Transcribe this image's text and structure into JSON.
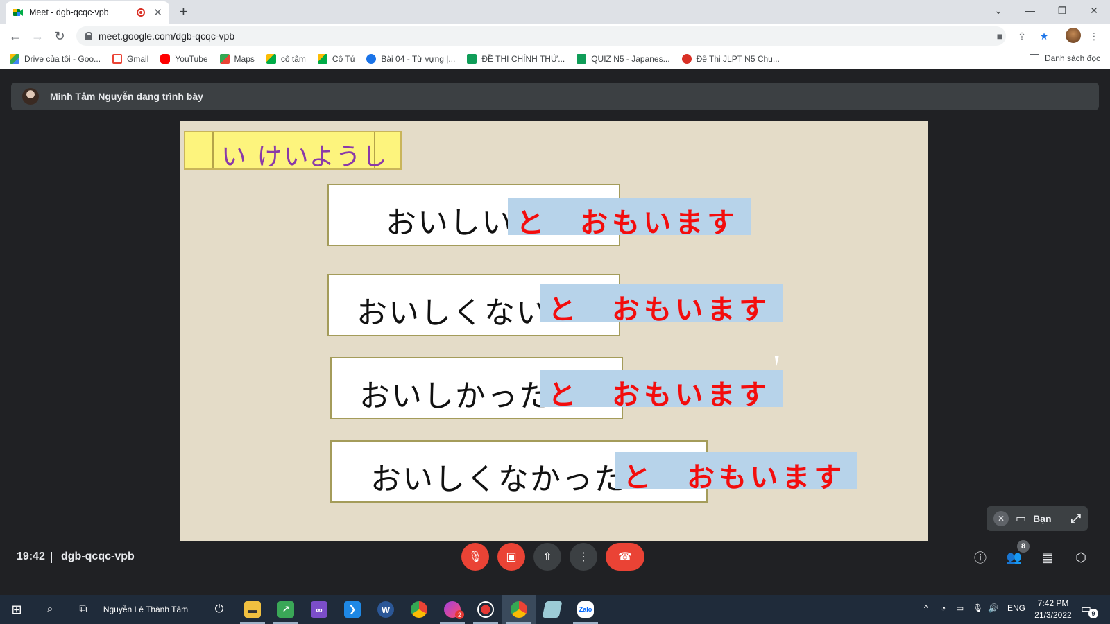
{
  "browser": {
    "tab_title": "Meet - dgb-qcqc-vpb",
    "tab_close": "✕",
    "new_tab": "+",
    "window_controls": [
      "⌄",
      "—",
      "❐",
      "✕"
    ],
    "url": "meet.google.com/dgb-qcqc-vpb",
    "bookmarks": [
      {
        "label": "Drive của tôi - Goo...",
        "icon": "drive-icon",
        "color": "#34a853"
      },
      {
        "label": "Gmail",
        "icon": "gmail-icon",
        "color": "#ea4335"
      },
      {
        "label": "YouTube",
        "icon": "youtube-icon",
        "color": "#ff0000"
      },
      {
        "label": "Maps",
        "icon": "maps-icon",
        "color": "#34a853"
      },
      {
        "label": "cô tâm",
        "icon": "meet-icon",
        "color": "#00897b"
      },
      {
        "label": "Cô Tú",
        "icon": "meet-icon",
        "color": "#00897b"
      },
      {
        "label": "Bài 04 - Từ vựng |...",
        "icon": "site-icon",
        "color": "#1a73e8"
      },
      {
        "label": "ĐỀ THI CHÍNH THỨ...",
        "icon": "sheets-icon",
        "color": "#0f9d58"
      },
      {
        "label": "QUIZ N5 - Japanes...",
        "icon": "sheets-icon",
        "color": "#0f9d58"
      },
      {
        "label": "Đề Thi JLPT N5 Chu...",
        "icon": "site-icon",
        "color": "#d93025"
      }
    ],
    "reading_list": "Danh sách đọc"
  },
  "meet": {
    "presenter_text": "Minh Tâm Nguyễn đang trình bày",
    "self_label": "Bạn",
    "time": "19:42",
    "meeting_code": "dgb-qcqc-vpb",
    "participants_count": "8"
  },
  "slide": {
    "title": "い けいようし",
    "rows": [
      {
        "base": "おいしい",
        "suffix": "と　おもいます"
      },
      {
        "base": "おいしくない",
        "suffix": "と　おもいます"
      },
      {
        "base": "おいしかった",
        "suffix": "と　おもいます"
      },
      {
        "base": "おいしくなかった",
        "suffix": "と　おもいます"
      }
    ]
  },
  "taskbar": {
    "user": "Nguyễn Lê Thành Tâm",
    "language": "ENG",
    "clock_time": "7:42 PM",
    "clock_date": "21/3/2022",
    "notifications": "9",
    "messenger_badge": "2"
  },
  "colors": {
    "meet_bg": "#202124",
    "slide_bg": "#e4dcc8",
    "title_fill": "#fdf47d",
    "highlight": "#b7d3ea",
    "suffix_text": "#f30d0d",
    "end_call": "#ea4335"
  }
}
